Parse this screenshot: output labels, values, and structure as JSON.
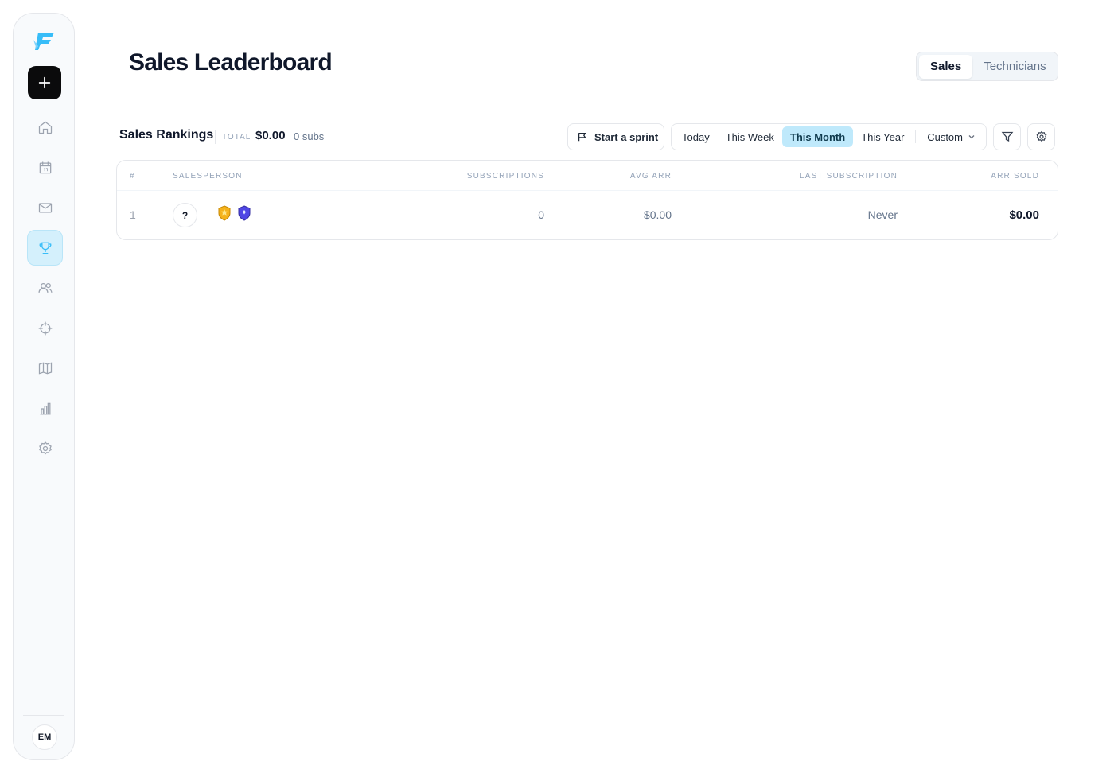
{
  "sidebar": {
    "new_label": "+",
    "user_initials": "EM",
    "items": [
      {
        "name": "home"
      },
      {
        "name": "calendar"
      },
      {
        "name": "mail"
      },
      {
        "name": "leaderboard",
        "active": true
      },
      {
        "name": "users"
      },
      {
        "name": "target"
      },
      {
        "name": "map"
      },
      {
        "name": "reports"
      },
      {
        "name": "settings"
      }
    ]
  },
  "header": {
    "title": "Sales Leaderboard",
    "tabs": [
      "Sales",
      "Technicians"
    ],
    "active_tab": "Sales"
  },
  "rankings": {
    "title": "Sales Rankings",
    "total_label": "TOTAL",
    "total_value": "$0.00",
    "subs_count": "0 subs",
    "sprint_label": "Start a sprint",
    "ranges": [
      "Today",
      "This Week",
      "This Month",
      "This Year",
      "Custom"
    ],
    "active_range": "This Month"
  },
  "table": {
    "headers": {
      "rank": "#",
      "salesperson": "Salesperson",
      "subscriptions": "Subscriptions",
      "avg_arr": "Avg ARR",
      "last_subscription": "Last Subscription",
      "arr_sold": "ARR Sold"
    },
    "rows": [
      {
        "rank": "1",
        "avatar": "?",
        "subscriptions": "0",
        "avg_arr": "$0.00",
        "last_subscription": "Never",
        "arr_sold": "$0.00"
      }
    ]
  },
  "colors": {
    "accent": "#38bdf8",
    "active_range_bg": "#bfe9fb",
    "badge_gold": "#f5b21b",
    "badge_blue": "#4f46e5"
  }
}
